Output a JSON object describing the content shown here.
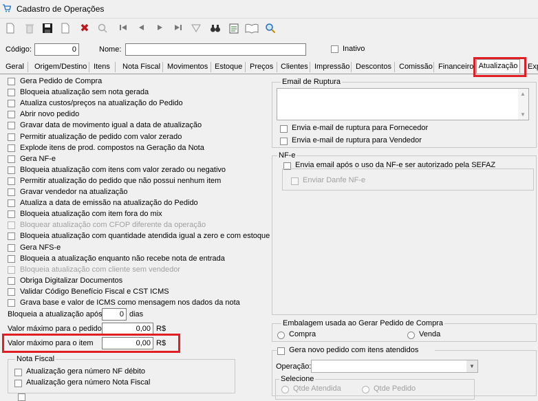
{
  "window": {
    "title": "Cadastro de Operações",
    "icon": "cart-icon"
  },
  "toolbar": {
    "buttons": [
      {
        "name": "new-icon"
      },
      {
        "name": "delete-icon"
      },
      {
        "name": "save-icon"
      },
      {
        "name": "copy-icon"
      },
      {
        "name": "cancel-icon"
      },
      {
        "name": "search-icon"
      },
      {
        "name": "first-icon"
      },
      {
        "name": "prev-icon"
      },
      {
        "name": "next-icon"
      },
      {
        "name": "last-icon"
      },
      {
        "name": "filter-icon"
      },
      {
        "name": "binoculars-icon"
      },
      {
        "name": "report-icon"
      },
      {
        "name": "book-icon"
      },
      {
        "name": "zoom-icon"
      }
    ]
  },
  "header": {
    "codigo_label": "Código:",
    "codigo_value": "0",
    "nome_label": "Nome:",
    "nome_value": "",
    "inativo_label": "Inativo"
  },
  "tabs": [
    "Geral",
    "Origem/Destino",
    "Itens",
    "Nota Fiscal",
    "Movimentos",
    "Estoque",
    "Preços",
    "Clientes",
    "Impressão",
    "Descontos",
    "Comissão",
    "Financeiro",
    "Atualização",
    "Exp"
  ],
  "active_tab": "Atualização",
  "checklist": [
    {
      "label": "Gera Pedido de Compra",
      "disabled": false
    },
    {
      "label": "Bloqueia atualização sem nota gerada",
      "disabled": false
    },
    {
      "label": "Atualiza custos/preços na atualização do Pedido",
      "disabled": false
    },
    {
      "label": "Abrir novo pedido",
      "disabled": false
    },
    {
      "label": "Gravar data de movimento igual a data de atualização",
      "disabled": false
    },
    {
      "label": "Permitir atualização de pedido com valor zerado",
      "disabled": false
    },
    {
      "label": "Explode itens de prod. compostos na Geração da Nota",
      "disabled": false
    },
    {
      "label": "Gera NF-e",
      "disabled": false
    },
    {
      "label": "Bloqueia atualização com itens com valor zerado ou negativo",
      "disabled": false
    },
    {
      "label": "Permitir atualização do pedido que não possui nenhum item",
      "disabled": false
    },
    {
      "label": "Gravar vendedor na atualização",
      "disabled": false
    },
    {
      "label": "Atualiza a data de emissão na atualização do Pedido",
      "disabled": false
    },
    {
      "label": "Bloqueia atualização com item fora do mix",
      "disabled": false
    },
    {
      "label": "Bloquear atualização com CFOP diferente da operação",
      "disabled": true
    },
    {
      "label": "Bloqueia atualização com quantidade atendida igual a zero e com estoque",
      "disabled": false
    },
    {
      "label": "Gera NFS-e",
      "disabled": false
    },
    {
      "label": "Bloqueia a atualização enquanto não recebe nota de entrada",
      "disabled": false
    },
    {
      "label": "Bloqueia atualização com cliente sem vendedor",
      "disabled": true
    },
    {
      "label": "Obriga Digitalizar Documentos",
      "disabled": false
    },
    {
      "label": "Validar Código Benefício Fiscal e CST ICMS",
      "disabled": false
    },
    {
      "label": "Grava base e valor de ICMS como mensagem nos dados da nota",
      "disabled": false
    }
  ],
  "fields": {
    "bloqueia_label": "Bloqueia a atualização após:",
    "bloqueia_value": "0",
    "bloqueia_unit": "dias",
    "max_pedido_label": "Valor máximo para o pedido",
    "max_pedido_value": "0,00",
    "max_pedido_unit": "R$",
    "max_item_label": "Valor máximo para o item",
    "max_item_value": "0,00",
    "max_item_unit": "R$"
  },
  "nota_fiscal_group": {
    "title": "Nota Fiscal",
    "items": [
      "Atualização gera número NF débito",
      "Atualização gera número Nota Fiscal"
    ]
  },
  "email_group": {
    "title": "Email de Ruptura",
    "items": [
      "Envia e-mail de ruptura para Fornecedor",
      "Envia e-mail de ruptura para Vendedor"
    ]
  },
  "nfe_group": {
    "title": "NF-e",
    "item": "Envia email após o uso da NF-e ser autorizado pela SEFAZ",
    "sub_item": "Enviar Danfe NF-e"
  },
  "embalagem_group": {
    "title": "Embalagem usada ao Gerar Pedido de Compra",
    "options": [
      "Compra",
      "Venda"
    ]
  },
  "novo_pedido_group": {
    "title": "Gera novo pedido com itens atendidos",
    "operacao_label": "Operação:",
    "operacao_value": "",
    "selecione_title": "Selecione",
    "options": [
      "Qtde Atendida",
      "Qtde Pedido"
    ]
  },
  "colors": {
    "highlight": "#e01e24",
    "disabled_text": "#a0a0a0"
  }
}
